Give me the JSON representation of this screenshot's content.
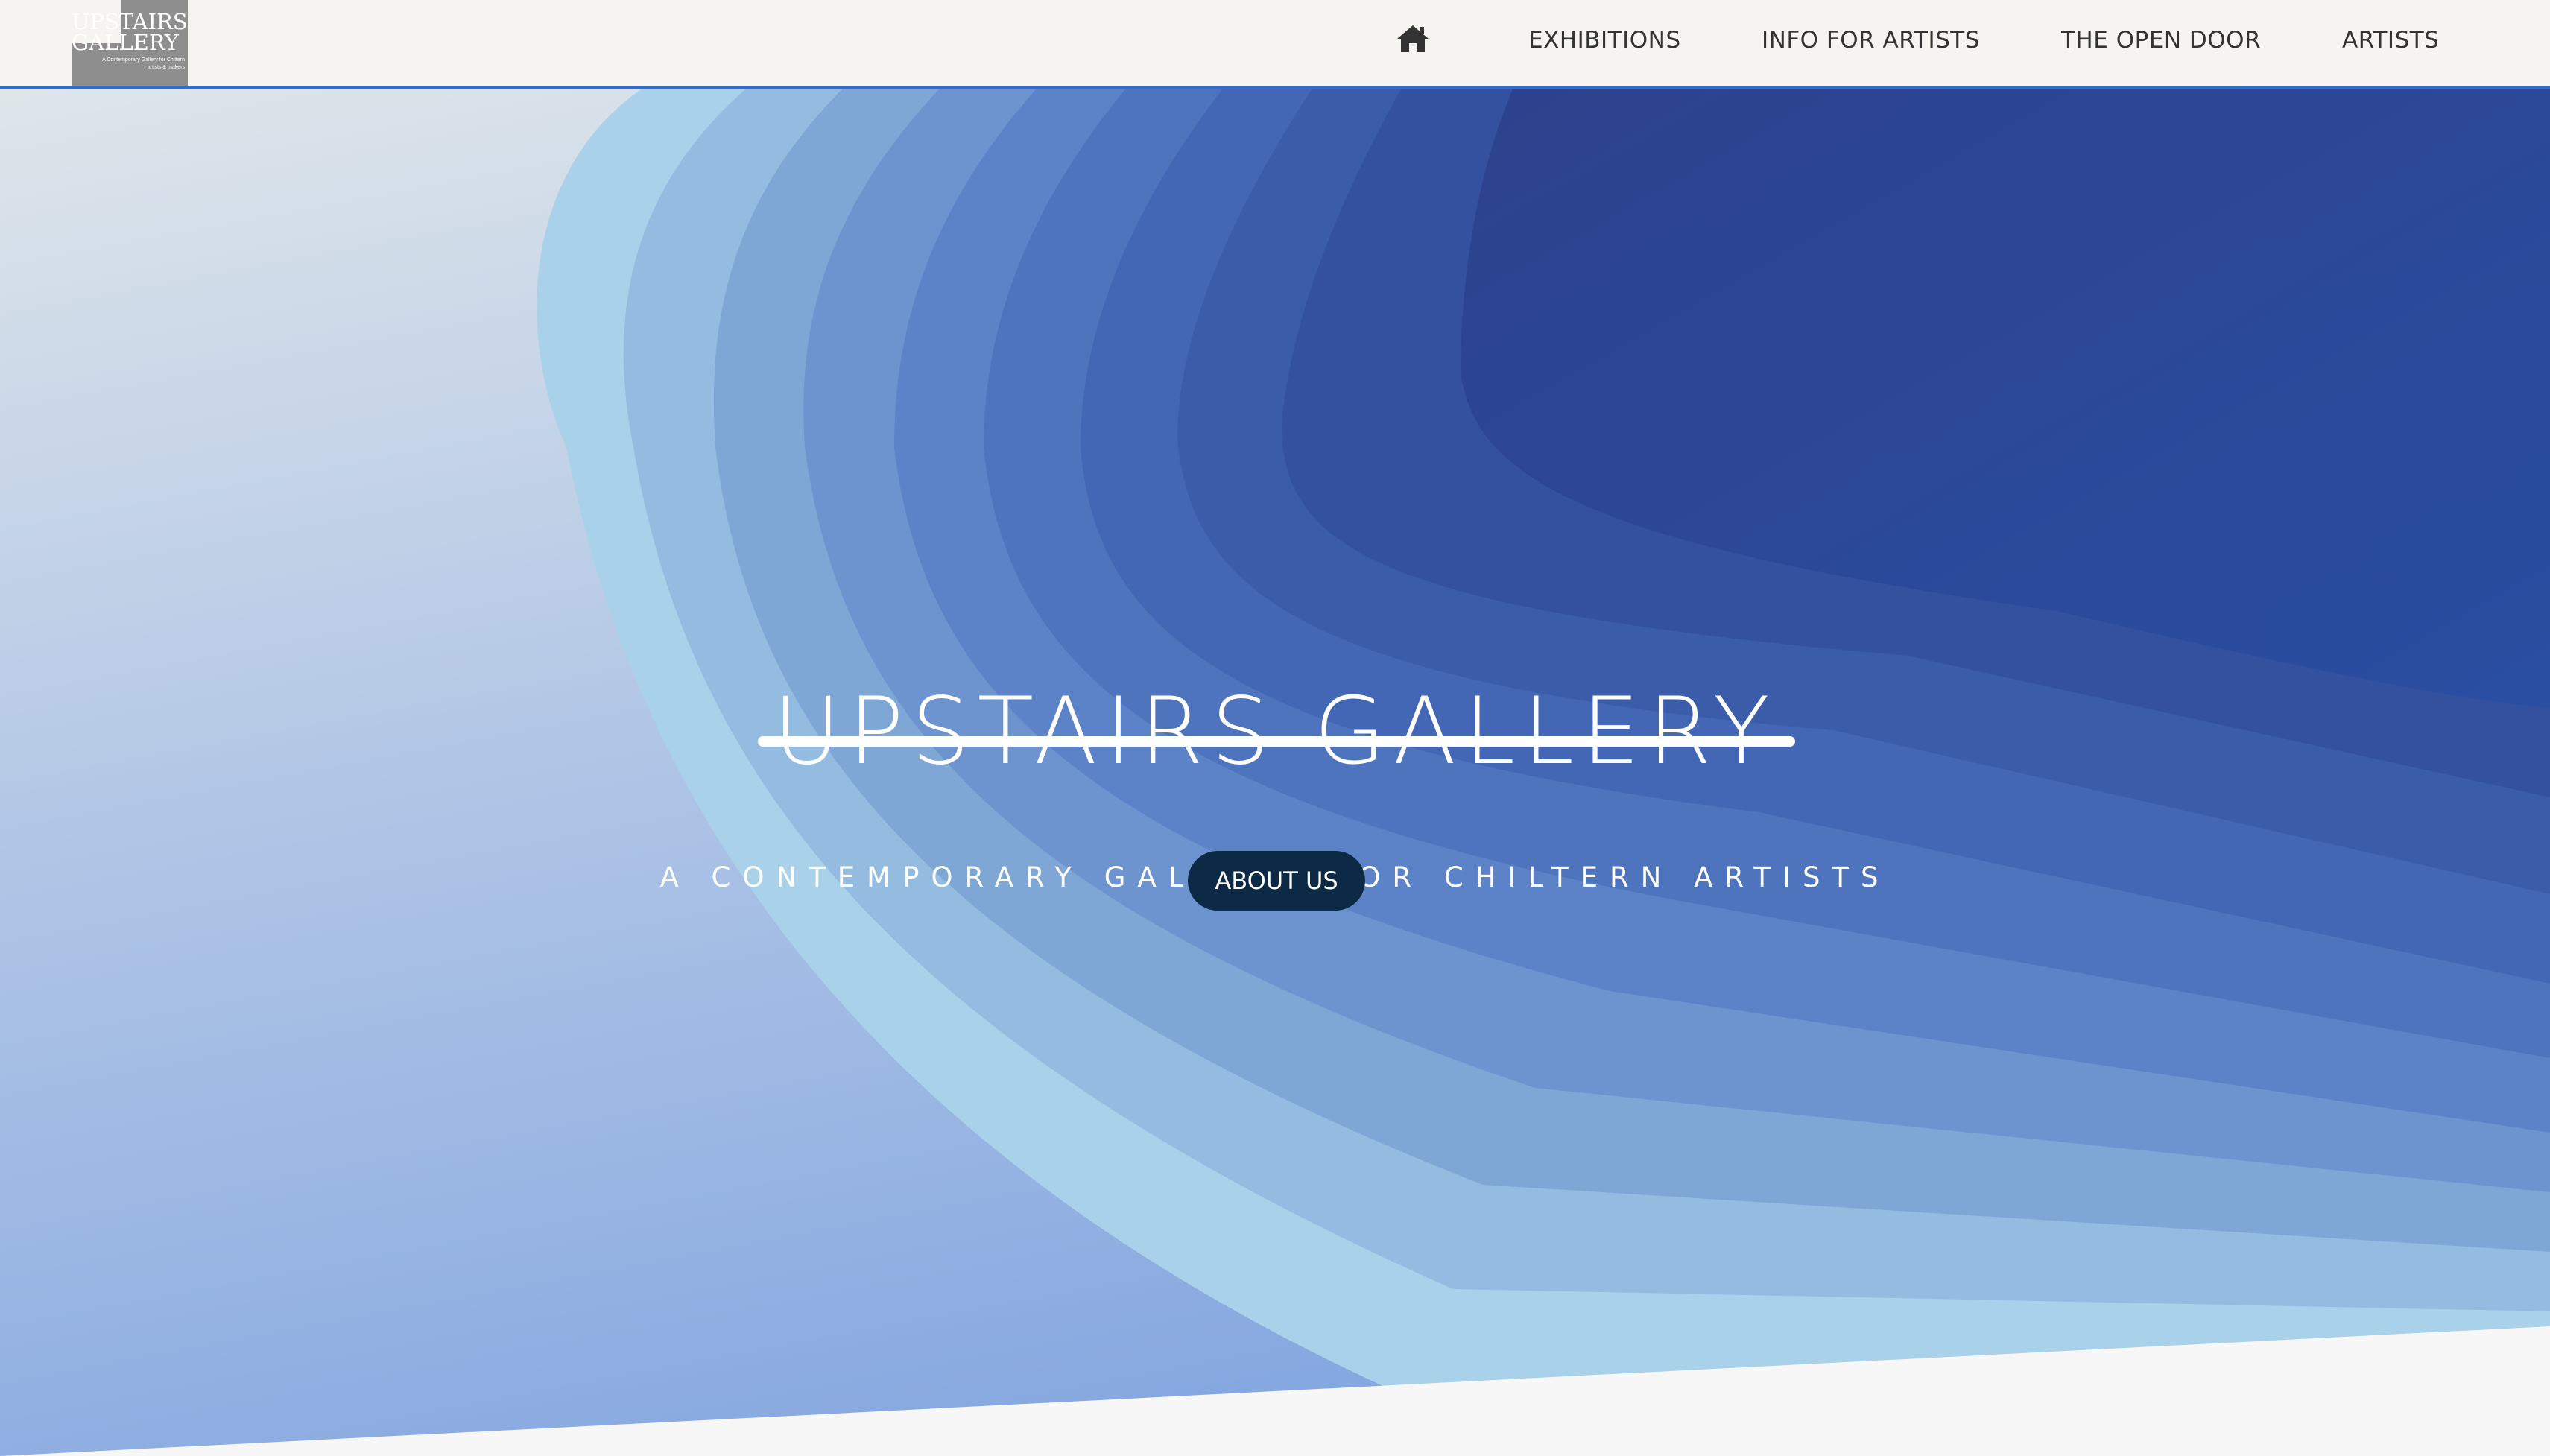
{
  "header": {
    "logo": {
      "line1": "UPSTAIRS",
      "line2": "GALLERY",
      "tagline": "A Contemporary Gallery for Chiltern artists & makers"
    },
    "home_icon": "home-icon",
    "nav": [
      {
        "label": "EXHIBITIONS"
      },
      {
        "label": "INFO FOR ARTISTS"
      },
      {
        "label": "THE OPEN DOOR"
      },
      {
        "label": "ARTISTS"
      }
    ]
  },
  "hero": {
    "title": "UPSTAIRS GALLERY",
    "subtitle": "A CONTEMPORARY GALLERY FOR CHILTERN ARTISTS",
    "cta_label": "ABOUT US"
  },
  "colors": {
    "nav_background": "#f5f4f0",
    "nav_border": "#2f6bd0",
    "nav_text": "#333333",
    "hero_deep_blue": "#2a4690",
    "hero_light_blue": "#a9d3ea",
    "button_background": "#0c2a46",
    "text_white": "#ffffff"
  }
}
